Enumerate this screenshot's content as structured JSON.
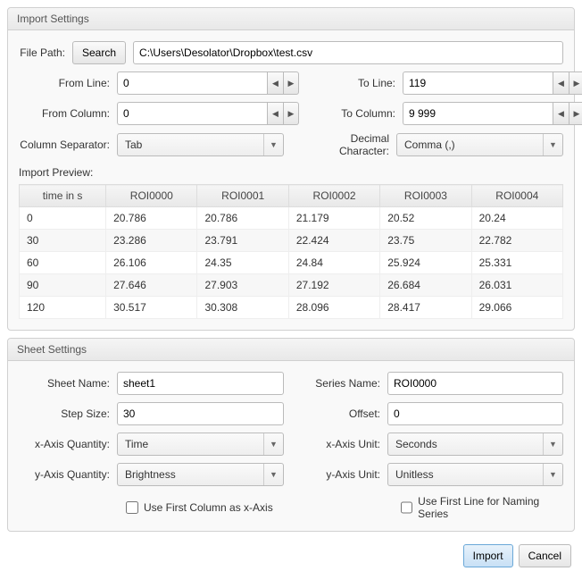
{
  "import": {
    "title": "Import Settings",
    "filePathLabel": "File Path:",
    "searchBtn": "Search",
    "filePath": "C:\\Users\\Desolator\\Dropbox\\test.csv",
    "fromLineLabel": "From Line:",
    "fromLine": "0",
    "toLineLabel": "To Line:",
    "toLine": "119",
    "fromColLabel": "From Column:",
    "fromCol": "0",
    "toColLabel": "To Column:",
    "toCol": "9 999",
    "colSepLabel": "Column Separator:",
    "colSep": "Tab",
    "decCharLabel": "Decimal Character:",
    "decChar": "Comma (,)",
    "previewLabel": "Import Preview:",
    "headers": [
      "time in s",
      "ROI0000",
      "ROI0001",
      "ROI0002",
      "ROI0003",
      "ROI0004"
    ],
    "rows": [
      [
        "0",
        "20.786",
        "20.786",
        "21.179",
        "20.52",
        "20.24"
      ],
      [
        "30",
        "23.286",
        "23.791",
        "22.424",
        "23.75",
        "22.782"
      ],
      [
        "60",
        "26.106",
        "24.35",
        "24.84",
        "25.924",
        "25.331"
      ],
      [
        "90",
        "27.646",
        "27.903",
        "27.192",
        "26.684",
        "26.031"
      ],
      [
        "120",
        "30.517",
        "30.308",
        "28.096",
        "28.417",
        "29.066"
      ]
    ]
  },
  "sheet": {
    "title": "Sheet Settings",
    "sheetNameLabel": "Sheet Name:",
    "sheetName": "sheet1",
    "seriesNameLabel": "Series Name:",
    "seriesName": "ROI0000",
    "stepSizeLabel": "Step Size:",
    "stepSize": "30",
    "offsetLabel": "Offset:",
    "offset": "0",
    "xQtyLabel": "x-Axis Quantity:",
    "xQty": "Time",
    "xUnitLabel": "x-Axis Unit:",
    "xUnit": "Seconds",
    "yQtyLabel": "y-Axis Quantity:",
    "yQty": "Brightness",
    "yUnitLabel": "y-Axis Unit:",
    "yUnit": "Unitless",
    "useFirstColLabel": "Use First Column as x-Axis",
    "useFirstLineLabel": "Use First Line for Naming Series"
  },
  "footer": {
    "import": "Import",
    "cancel": "Cancel"
  }
}
